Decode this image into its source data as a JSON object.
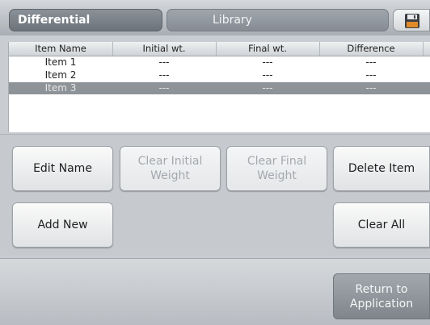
{
  "tabs": {
    "active": "Differential",
    "inactive": "Library"
  },
  "toolbar": {
    "save_icon": "save-icon"
  },
  "table": {
    "headers": [
      "Item Name",
      "Initial wt.",
      "Final wt.",
      "Difference"
    ],
    "rows": [
      {
        "name": "Item 1",
        "initial": "---",
        "final": "---",
        "difference": "---"
      },
      {
        "name": "Item 2",
        "initial": "---",
        "final": "---",
        "difference": "---"
      },
      {
        "name": "Item 3",
        "initial": "---",
        "final": "---",
        "difference": "---",
        "selected": true
      }
    ]
  },
  "buttons": {
    "edit_name": "Edit Name",
    "clear_initial": "Clear Initial\nWeight",
    "clear_final": "Clear Final\nWeight",
    "delete_item": "Delete Item",
    "add_new": "Add New",
    "clear_all": "Clear All"
  },
  "footer": {
    "return": "Return to\nApplication"
  },
  "colors": {
    "selected_row": "#8e9397",
    "disabled_text": "#a4a9ae"
  }
}
